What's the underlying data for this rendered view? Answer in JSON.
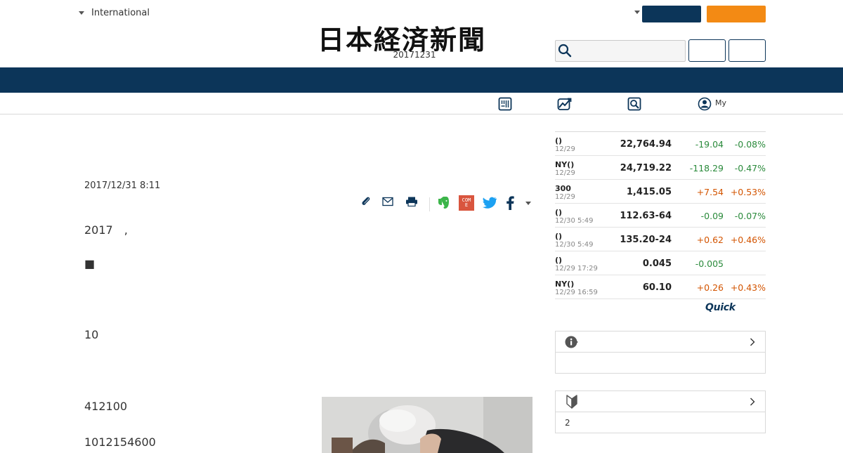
{
  "header": {
    "edition_label": "International",
    "logo_text": "日本経済新聞",
    "paper_date": "20171231",
    "navy_button_label": "",
    "orange_button_label": "",
    "search_placeholder": "",
    "outline_button_1_label": "",
    "outline_button_2_label": "",
    "colors": {
      "navy": "#0c3559",
      "orange": "#f38a14"
    }
  },
  "subnav": {
    "items": [
      {
        "icon": "newspaper-icon",
        "label": ""
      },
      {
        "icon": "chart-icon",
        "label": ""
      },
      {
        "icon": "search-doc-icon",
        "label": ""
      },
      {
        "icon": "user-icon",
        "label": "My"
      }
    ]
  },
  "article": {
    "date": "2017/12/31 8:11",
    "paragraphs": [
      "2017　,",
      "■",
      "10",
      "412100",
      "1012154600"
    ],
    "share_icons": [
      "clip-icon",
      "mail-icon",
      "print-icon",
      "evernote-icon",
      "come-icon",
      "twitter-icon",
      "facebook-icon",
      "more-caret-icon"
    ],
    "come_label": "COME"
  },
  "market": {
    "rows": [
      {
        "name": "()",
        "time": "12/29",
        "value": "22,764.94",
        "change": "-19.04",
        "percent": "-0.08%",
        "dir": "down"
      },
      {
        "name": "NY()",
        "time": "12/29",
        "value": "24,719.22",
        "change": "-118.29",
        "percent": "-0.47%",
        "dir": "down"
      },
      {
        "name": "300",
        "time": "12/29",
        "value": "1,415.05",
        "change": "+7.54",
        "percent": "+0.53%",
        "dir": "up"
      },
      {
        "name": "()",
        "time": "12/30 5:49",
        "value": "112.63-64",
        "change": "-0.09",
        "percent": "-0.07%",
        "dir": "down"
      },
      {
        "name": "()",
        "time": "12/30 5:49",
        "value": "135.20-24",
        "change": "+0.62",
        "percent": "+0.46%",
        "dir": "up"
      },
      {
        "name": "()",
        "time": "12/29 17:29",
        "value": "0.045",
        "change": "-0.005",
        "percent": "",
        "dir": "down"
      },
      {
        "name": "NY()",
        "time": "12/29 16:59",
        "value": "60.10",
        "change": "+0.26",
        "percent": "+0.43%",
        "dir": "up"
      }
    ],
    "provider_logo": "Quick",
    "colors": {
      "down": "#2a8a3b",
      "up": "#d35400"
    }
  },
  "info_box": {
    "title": "",
    "body": ""
  },
  "beginner_box": {
    "title": "",
    "body": "2"
  }
}
